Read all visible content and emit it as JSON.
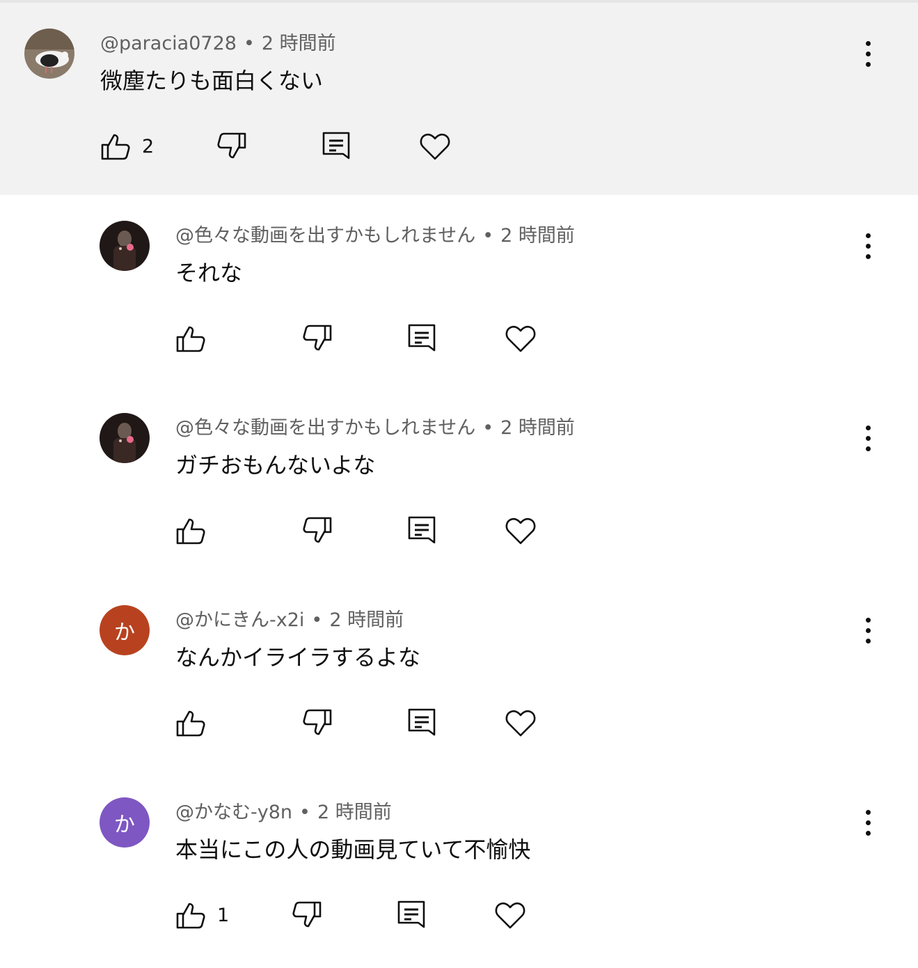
{
  "comments": [
    {
      "author": "@paracia0728",
      "time": "2 時間前",
      "text": "微塵たりも面白くない",
      "likes": "2",
      "avatar_text": "",
      "avatar_color": "#8a7a6a"
    },
    {
      "author": "@色々な動画を出すかもしれません",
      "time": "2 時間前",
      "text": "それな",
      "likes": "",
      "avatar_text": "",
      "avatar_color": "#2a1f1d"
    },
    {
      "author": "@色々な動画を出すかもしれません",
      "time": "2 時間前",
      "text": "ガチおもんないよな",
      "likes": "",
      "avatar_text": "",
      "avatar_color": "#2a1f1d"
    },
    {
      "author": "@かにきん-x2i",
      "time": "2 時間前",
      "text": "なんかイライラするよな",
      "likes": "",
      "avatar_text": "か",
      "avatar_color": "#b8421f"
    },
    {
      "author": "@かなむ-y8n",
      "time": "2 時間前",
      "text": "本当にこの人の動画見ていて不愉快",
      "likes": "1",
      "avatar_text": "か",
      "avatar_color": "#7e57c2"
    }
  ],
  "separator": "•"
}
